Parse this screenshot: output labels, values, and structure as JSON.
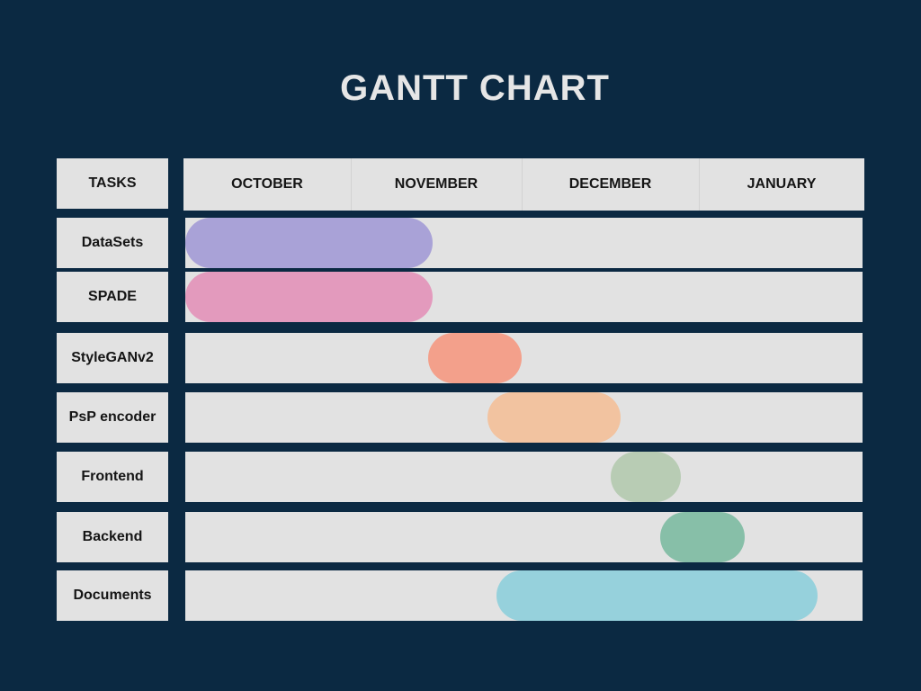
{
  "chart_data": {
    "type": "gantt",
    "title": "GANTT CHART",
    "task_header": "TASKS",
    "months": [
      "OCTOBER",
      "NOVEMBER",
      "DECEMBER",
      "JANUARY"
    ],
    "tasks": [
      {
        "name": "DataSets",
        "start": 0.0,
        "end": 1.48,
        "color": "#a9a2d7"
      },
      {
        "name": "SPADE",
        "start": 0.0,
        "end": 1.48,
        "color": "#e39abd"
      },
      {
        "name": "StyleGANv2",
        "start": 1.45,
        "end": 2.0,
        "color": "#f3a08b"
      },
      {
        "name": "PsP encoder",
        "start": 1.8,
        "end": 2.56,
        "color": "#f2c3a0"
      },
      {
        "name": "Frontend",
        "start": 2.5,
        "end": 2.9,
        "color": "#b8ccb4"
      },
      {
        "name": "Backend",
        "start": 2.78,
        "end": 3.28,
        "color": "#87bfa8"
      },
      {
        "name": "Documents",
        "start": 1.85,
        "end": 3.72,
        "color": "#96d1dc"
      }
    ]
  }
}
